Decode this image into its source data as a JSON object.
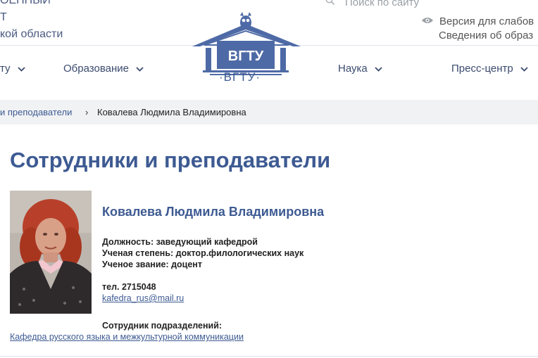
{
  "header": {
    "university_name_lines": [
      "ОЕННЫЙ",
      "Т",
      "кой области"
    ],
    "search_placeholder": "Поиск по сайту",
    "accessibility_label": "Версия для слабов",
    "info_link": "Сведения об образ",
    "logo_text": "·ВГТУ·",
    "colors": {
      "brand": "#3d5a92",
      "logo": "#4e6aa6"
    }
  },
  "nav": {
    "items": [
      {
        "label": "ту",
        "icon": "chevron-down-icon"
      },
      {
        "label": "Образование",
        "icon": "chevron-down-icon"
      },
      {
        "label": "Наука",
        "icon": "chevron-down-icon"
      },
      {
        "label": "Пресс-центр",
        "icon": "chevron-down-icon"
      }
    ]
  },
  "breadcrumb": {
    "parent": "и преподаватели",
    "separator": "›",
    "current": "Ковалева Людмила Владимировна"
  },
  "page_title": "Сотрудники и преподаватели",
  "person": {
    "name": "Ковалева Людмила Владимировна",
    "position": "Должность: заведующий кафедрой",
    "degree": "Ученая степень: доктор.филологических наук",
    "title": "Ученое звание: доцент",
    "phone": "тел. 2715048",
    "email": "kafedra_rus@mail.ru",
    "department_label": "Сотрудник подразделений:",
    "department_link": "Кафедра русского языка и межкультурной коммуникации"
  }
}
